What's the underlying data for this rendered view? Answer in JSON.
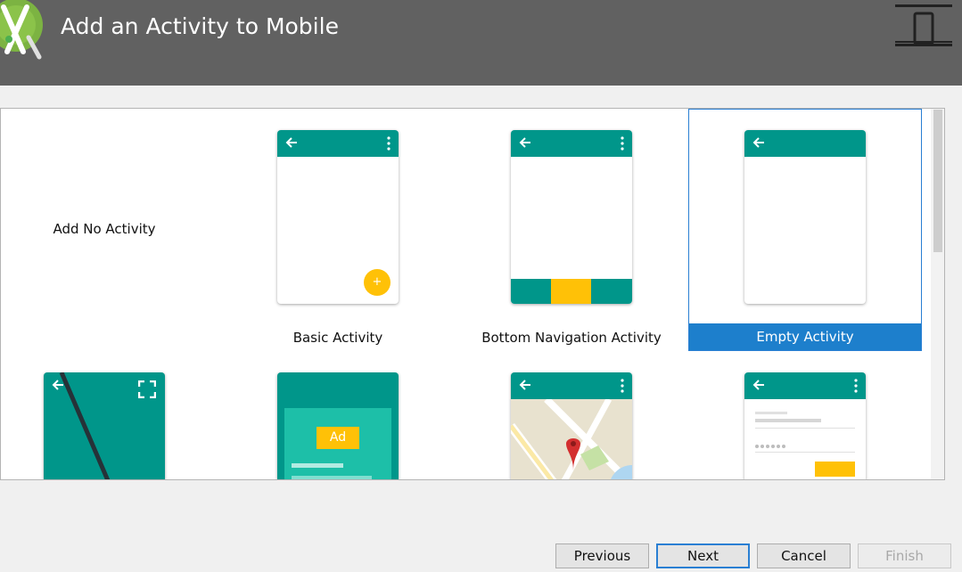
{
  "window": {
    "title": "Add an Activity to Mobile",
    "logo_icon": "android-studio-logo-icon",
    "device_icon": "mobile-device-icon",
    "header_color": "#616161"
  },
  "gallery": {
    "selected_color": "#1d7fcc",
    "template_color": "#00968a",
    "accent_color": "#ffc107",
    "tiles": [
      {
        "label": "Add No Activity"
      },
      {
        "label": "Basic Activity"
      },
      {
        "label": "Bottom Navigation Activity"
      },
      {
        "label": "Empty Activity",
        "selected": true
      }
    ],
    "ad_badge": "Ad"
  },
  "footer": {
    "previous": "Previous",
    "next": "Next",
    "cancel": "Cancel",
    "finish": "Finish"
  }
}
